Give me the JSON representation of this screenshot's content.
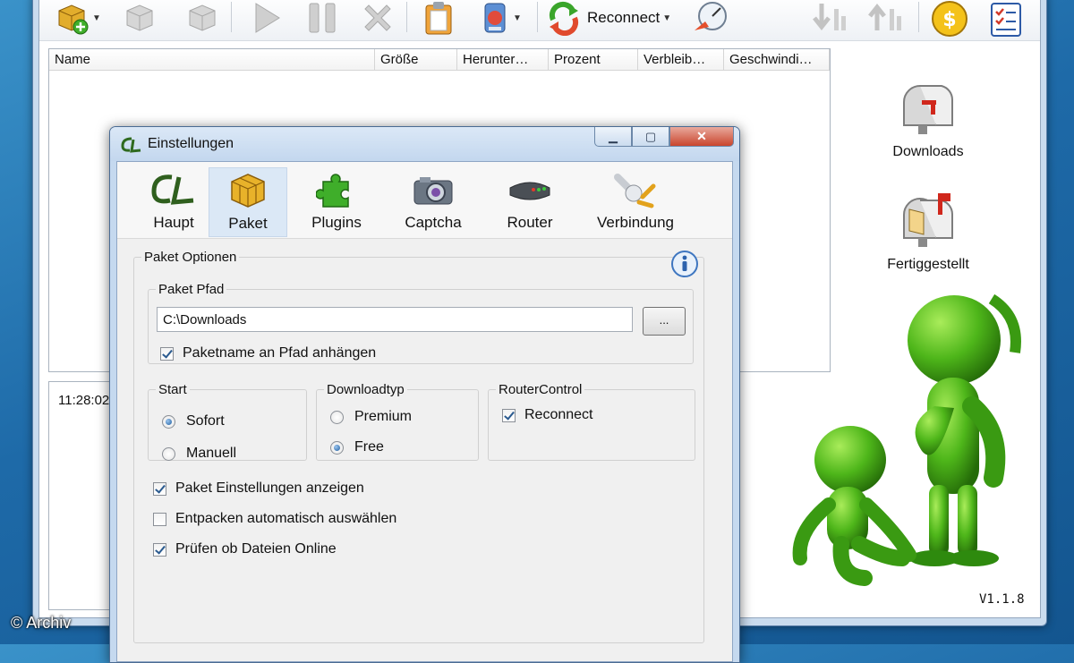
{
  "toolbar": {
    "reconnect_label": "Reconnect",
    "icons": [
      "add-package-icon",
      "remove-package-icon",
      "package-grey-icon",
      "play-icon",
      "pause-icon",
      "stop-icon",
      "clipboard-icon",
      "update-icon",
      "reconnect-icon",
      "speed-gauge-icon",
      "move-down-icon",
      "move-up-icon",
      "donate-icon",
      "checklist-icon"
    ]
  },
  "download_list": {
    "columns": [
      "Name",
      "Größe",
      "Herunter…",
      "Prozent",
      "Verbleib…",
      "Geschwindi…"
    ]
  },
  "log": {
    "time": "11:28:02"
  },
  "sidebar": {
    "downloads_label": "Downloads",
    "finished_label": "Fertiggestellt"
  },
  "version": "V1.1.8",
  "watermark": "© Archiv",
  "dialog": {
    "title": "Einstellungen",
    "tabs": [
      {
        "label": "Haupt",
        "icon": "cl-logo-icon"
      },
      {
        "label": "Paket",
        "icon": "package-icon"
      },
      {
        "label": "Plugins",
        "icon": "puzzle-icon"
      },
      {
        "label": "Captcha",
        "icon": "camera-icon"
      },
      {
        "label": "Router",
        "icon": "router-icon"
      },
      {
        "label": "Verbindung",
        "icon": "plug-icon"
      }
    ],
    "active_tab": "Paket",
    "options_group": "Paket Optionen",
    "path_group": "Paket Pfad",
    "path_value": "C:\\Downloads",
    "browse_label": "...",
    "append_name_label": "Paketname an Pfad anhängen",
    "append_name_checked": true,
    "start": {
      "label": "Start",
      "options": [
        "Sofort",
        "Manuell"
      ],
      "selected": "Sofort"
    },
    "downloadtyp": {
      "label": "Downloadtyp",
      "options": [
        "Premium",
        "Free"
      ],
      "selected": "Free"
    },
    "routercontrol": {
      "label": "RouterControl",
      "reconnect_label": "Reconnect",
      "reconnect_checked": true
    },
    "checkboxes": [
      {
        "label": "Paket Einstellungen anzeigen",
        "checked": true
      },
      {
        "label": "Entpacken automatisch auswählen",
        "checked": false
      },
      {
        "label": "Prüfen ob Dateien Online",
        "checked": true
      }
    ]
  }
}
